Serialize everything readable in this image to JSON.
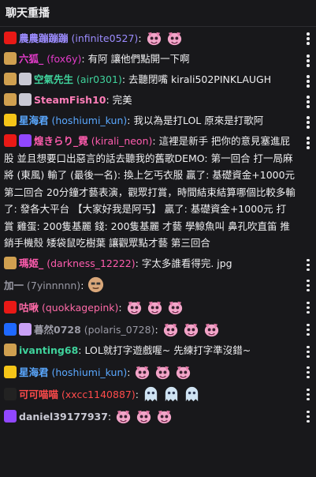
{
  "header": {
    "title": "聊天重播"
  },
  "messages": [
    {
      "name": "農農蹦蹦蹦",
      "login": "(infinite0527)",
      "text": "",
      "color": "#9c8cff",
      "emotes": [
        "pink-dragon",
        "pink-dragon"
      ],
      "badges": [
        "broadcaster-badge"
      ]
    },
    {
      "name": "六狐_",
      "login": "(fox6y)",
      "text": "有阿 讓他們點開一下啊",
      "color": "#e33bc9",
      "emotes": [],
      "badges": [
        "sub-badge"
      ]
    },
    {
      "name": "空氣先生",
      "login": "(air0301)",
      "text": "去聽閉嘴 kirali502PINKLAUGH",
      "color": "#3fd39c",
      "emotes": [],
      "badges": [
        "sub-badge",
        "bits-badge"
      ]
    },
    {
      "name": "SteamFish10",
      "login": "",
      "text": "完美",
      "color": "#ff7eb9",
      "emotes": [],
      "badges": [
        "sub-badge",
        "bits-badge"
      ]
    },
    {
      "name": "星海君",
      "login": "(hoshiumi_kun)",
      "text": "我以為是打LOL 原來是打歌阿",
      "color": "#5aa8ff",
      "emotes": [],
      "badges": [
        "crown-badge"
      ]
    },
    {
      "name": "煌きらり_霓",
      "login": "(kirali_neon)",
      "text": "這裡是新手 把你的意見塞進屁股 並且想要口出惡言的話去聽我的舊歌DEMO: 第一回合 打一局麻將 (東風) 輸了 (最後一名): 換上乞丐衣服 贏了: 基礎資金+1000元 第二回合 20分鐘才藝表演，觀眾打賞，時間結束結算哪個比較多輸了: 發各大平台 【大家好我是阿丐】 贏了: 基礎資金+1000元 打賞 雞蛋: 200隻基麗 錢: 200隻基麗 才藝 學鯨魚叫 鼻孔吹直笛 推銷手機殼 矮袋鼠吃樹葉 讓觀眾點才藝 第三回合",
      "color": "#ff5cae",
      "emotes": [],
      "badges": [
        "broadcaster-badge",
        "verified-badge"
      ]
    },
    {
      "name": "瑪姬_",
      "login": "(darkness_12222)",
      "text": "字太多誰看得完. jpg",
      "color": "#ff5cae",
      "emotes": [],
      "badges": [
        "sub-badge"
      ]
    },
    {
      "name": "加一",
      "login": "(7yinnnnn)",
      "text": "",
      "color": "#9a9aa5",
      "emotes": [
        "face-emote"
      ],
      "badges": []
    },
    {
      "name": "咕啾",
      "login": "(quokkagepink)",
      "text": "",
      "color": "#ff6aa8",
      "emotes": [
        "pink-dragon",
        "pink-dragon",
        "pink-dragon"
      ],
      "badges": [
        "heart-badge"
      ]
    },
    {
      "name": "暮然0728",
      "login": "(polaris_0728)",
      "text": "",
      "color": "#9a9aa5",
      "emotes": [
        "pink-dragon",
        "pink-dragon",
        "pink-dragon"
      ],
      "badges": [
        "star-badge",
        "cloud-badge"
      ]
    },
    {
      "name": "ivanting68",
      "login": "",
      "text": "LOL就打字遊戲喔~ 先練打字準沒錯~",
      "color": "#3fd39c",
      "emotes": [],
      "badges": [
        "sub-badge"
      ]
    },
    {
      "name": "星海君",
      "login": "(hoshiumi_kun)",
      "text": "",
      "color": "#5aa8ff",
      "emotes": [
        "pink-dragon",
        "pink-dragon",
        "pink-dragon"
      ],
      "badges": [
        "crown-badge"
      ]
    },
    {
      "name": "可可喵喵",
      "login": "(xxcc1140887)",
      "text": "",
      "color": "#ff4b4b",
      "emotes": [
        "ghost-emote",
        "ghost-emote",
        "ghost-emote"
      ],
      "badges": [
        "sparkle-badge"
      ]
    },
    {
      "name": "daniel39177937",
      "login": "",
      "text": "",
      "color": "#c9c9d4",
      "emotes": [
        "pink-dragon",
        "pink-dragon",
        "pink-dragon"
      ],
      "badges": [
        "bits-purple-badge"
      ]
    }
  ]
}
